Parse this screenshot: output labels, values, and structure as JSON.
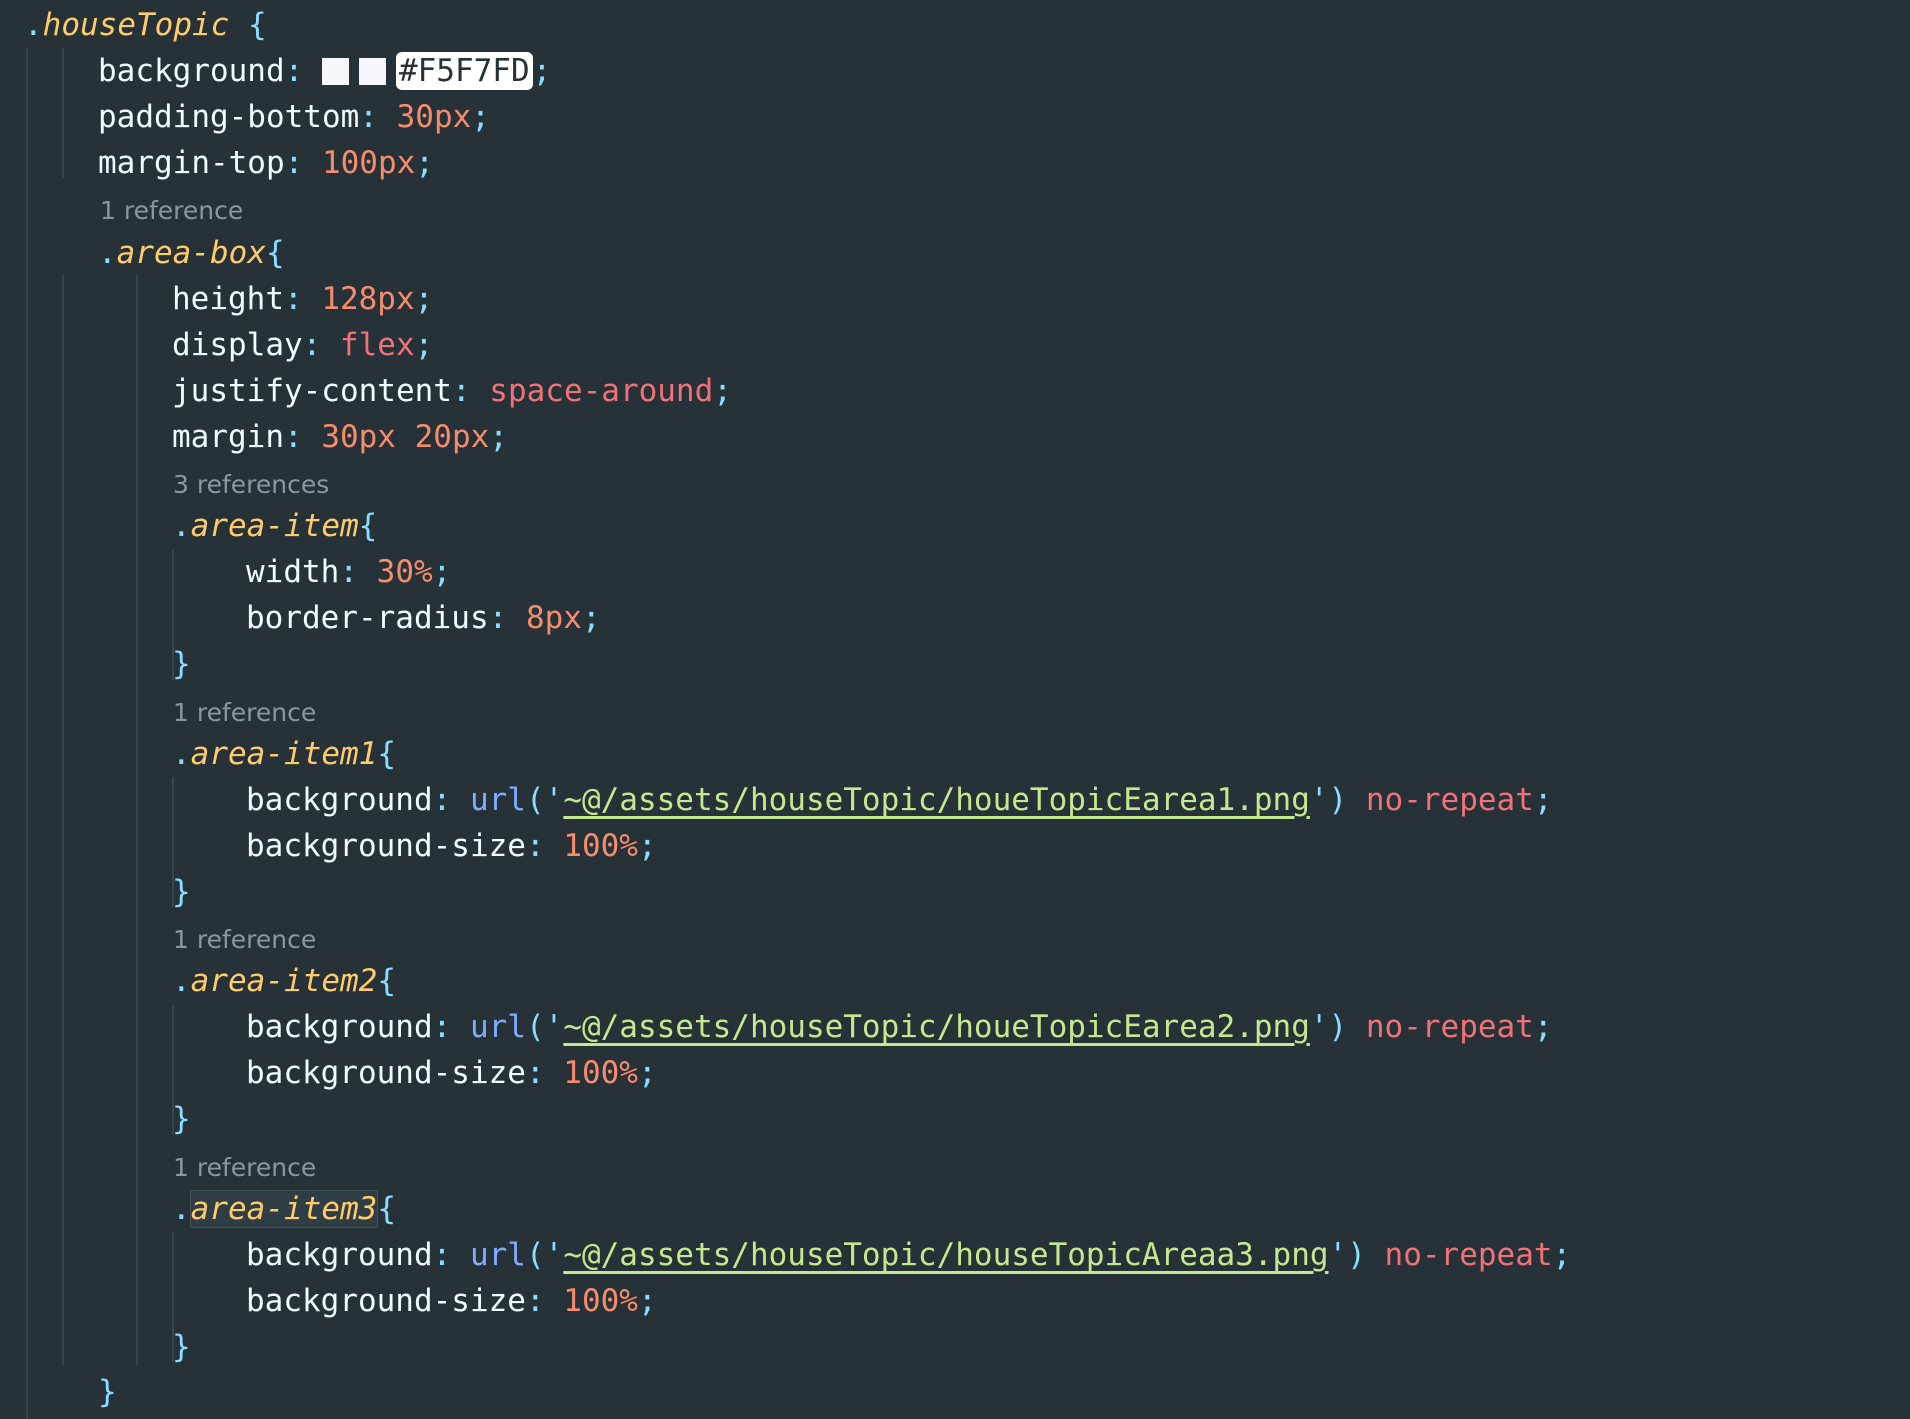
{
  "editor": {
    "language": "less",
    "theme_colors": {
      "background": "#263238",
      "selector": "#ffcb6b",
      "punctuation": "#89ddff",
      "property": "#eeffff",
      "number": "#f78c6c",
      "keyword": "#f07178",
      "function": "#82aaff",
      "string": "#c3e88d",
      "codelens": "#8a979e",
      "swatch": "#f5f7fd"
    },
    "lines": {
      "l1_sel": "houseTopic",
      "l1_brace": " {",
      "l2_prop": "background",
      "l2_colon": ": ",
      "l2_hex": "#F5F7FD",
      "l2_semi": ";",
      "l3_prop": "padding-bottom",
      "l3_colon": ": ",
      "l3_val": "30px",
      "l3_semi": ";",
      "l4_prop": "margin-top",
      "l4_colon": ": ",
      "l4_val": "100px",
      "l4_semi": ";",
      "lens1": "1 reference",
      "l5_sel": "area-box",
      "l5_brace": "{",
      "l6_prop": "height",
      "l6_colon": ": ",
      "l6_val": "128px",
      "l6_semi": ";",
      "l7_prop": "display",
      "l7_colon": ": ",
      "l7_val": "flex",
      "l7_semi": ";",
      "l8_prop": "justify-content",
      "l8_colon": ": ",
      "l8_val": "space-around",
      "l8_semi": ";",
      "l9_prop": "margin",
      "l9_colon": ": ",
      "l9_val": "30px 20px",
      "l9_semi": ";",
      "lens2": "3 references",
      "l10_sel": "area-item",
      "l10_brace": "{",
      "l11_prop": "width",
      "l11_colon": ": ",
      "l11_val": "30%",
      "l11_semi": ";",
      "l12_prop": "border-radius",
      "l12_colon": ": ",
      "l12_val": "8px",
      "l12_semi": ";",
      "l13_close": "}",
      "lens3": "1 reference",
      "l14_sel": "area-item1",
      "l14_brace": "{",
      "l15_prop": "background",
      "l15_colon": ": ",
      "l15_fn": "url",
      "l15_open": "(",
      "l15_q1": "'",
      "l15_path": "~@/assets/houseTopic/houeTopicEarea1.png",
      "l15_q2": "'",
      "l15_close": ")",
      "l15_kw": "no-repeat",
      "l15_semi": ";",
      "l16_prop": "background-size",
      "l16_colon": ": ",
      "l16_val": "100%",
      "l16_semi": ";",
      "l17_close": "}",
      "lens4": "1 reference",
      "l18_sel": "area-item2",
      "l18_brace": "{",
      "l19_prop": "background",
      "l19_colon": ": ",
      "l19_fn": "url",
      "l19_open": "(",
      "l19_q1": "'",
      "l19_path": "~@/assets/houseTopic/houeTopicEarea2.png",
      "l19_q2": "'",
      "l19_close": ")",
      "l19_kw": "no-repeat",
      "l19_semi": ";",
      "l20_prop": "background-size",
      "l20_colon": ": ",
      "l20_val": "100%",
      "l20_semi": ";",
      "l21_close": "}",
      "lens5": "1 reference",
      "l22_sel": "area-item3",
      "l22_brace": "{",
      "l23_prop": "background",
      "l23_colon": ": ",
      "l23_fn": "url",
      "l23_open": "(",
      "l23_q1": "'",
      "l23_path": "~@/assets/houseTopic/houseTopicAreaa3.png",
      "l23_q2": "'",
      "l23_close": ")",
      "l23_kw": "no-repeat",
      "l23_semi": ";",
      "l24_prop": "background-size",
      "l24_colon": ": ",
      "l24_val": "100%",
      "l24_semi": ";",
      "l25_close": "}",
      "l26_close": "}",
      "dot": "."
    }
  }
}
